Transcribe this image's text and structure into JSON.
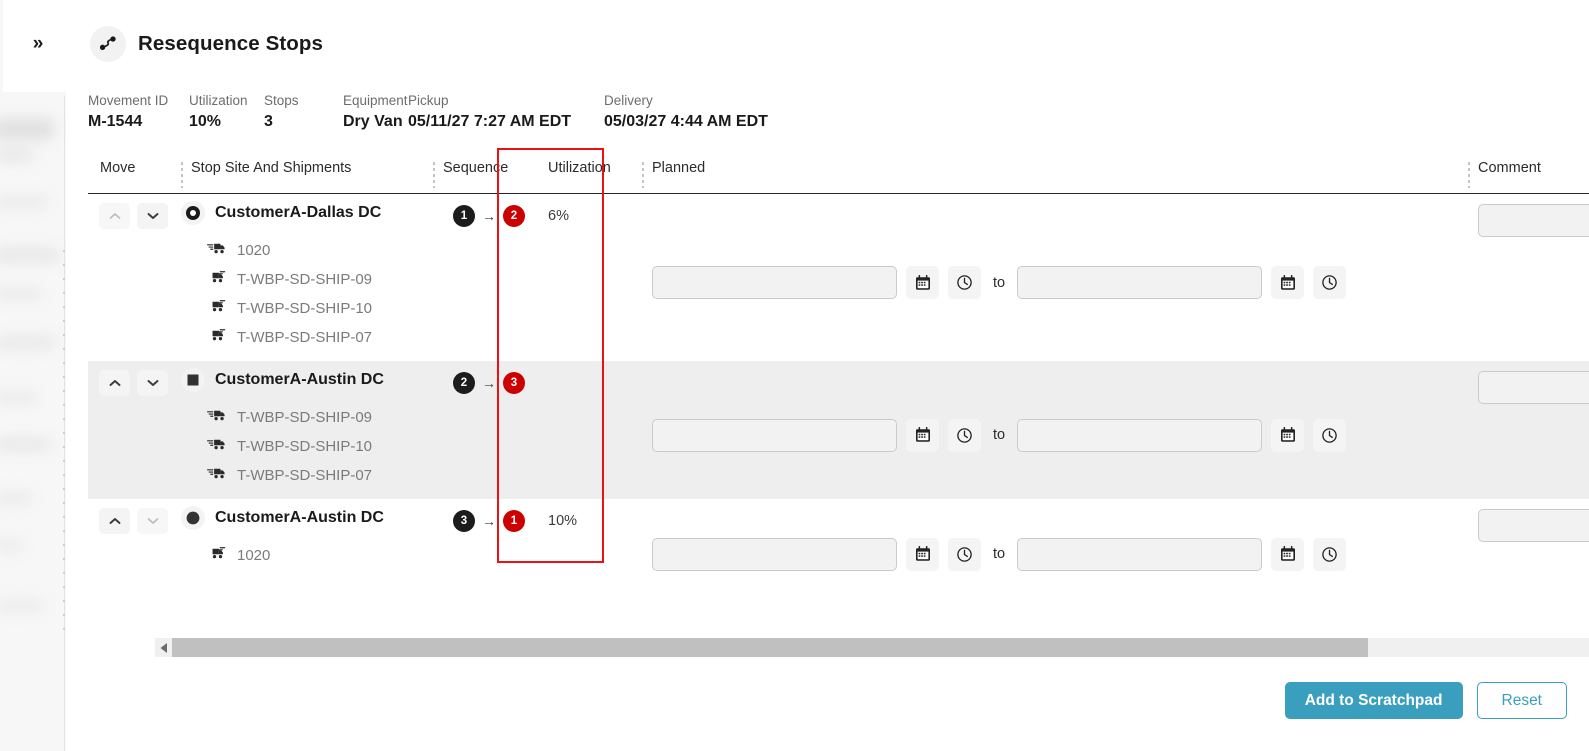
{
  "window": {
    "expand_button_label": "»",
    "title": "Resequence Stops",
    "title_icon": "route-stops-icon"
  },
  "summary": [
    {
      "label": "Movement ID",
      "value": "M-1544"
    },
    {
      "label": "Utilization",
      "value": "10%"
    },
    {
      "label": "Stops",
      "value": "3"
    },
    {
      "label": "Equipment",
      "value": "Dry Van"
    },
    {
      "label": "Pickup",
      "value": "05/11/27 7:27 AM EDT"
    },
    {
      "label": "Delivery",
      "value": "05/03/27 4:44 AM EDT"
    }
  ],
  "table": {
    "columns": [
      {
        "key": "move",
        "label": "Move"
      },
      {
        "key": "site",
        "label": "Stop Site And Shipments"
      },
      {
        "key": "sequence",
        "label": "Sequence"
      },
      {
        "key": "utilization",
        "label": "Utilization"
      },
      {
        "key": "planned",
        "label": "Planned"
      },
      {
        "key": "comment",
        "label": "Comment"
      }
    ],
    "rows": [
      {
        "marker": "origin-ring-icon",
        "site": "CustomerA-Dallas DC",
        "sequence_current": "1",
        "sequence_new": "2",
        "sequence_arrow": "→",
        "utilization": "6%",
        "move_up_enabled": false,
        "move_down_enabled": true,
        "highlighted": false,
        "shipments": [
          {
            "icon": "truck-arrive-icon",
            "label": "1020"
          },
          {
            "icon": "truck-depart-icon",
            "label": "T-WBP-SD-SHIP-09"
          },
          {
            "icon": "truck-depart-icon",
            "label": "T-WBP-SD-SHIP-10"
          },
          {
            "icon": "truck-depart-icon",
            "label": "T-WBP-SD-SHIP-07"
          }
        ],
        "planned": {
          "date_value": "",
          "time_value": "",
          "to_label": "to",
          "date_icon": "calendar-icon",
          "time_icon": "clock-icon"
        },
        "comment": ""
      },
      {
        "marker": "stop-square-icon",
        "site": "CustomerA-Austin DC",
        "sequence_current": "2",
        "sequence_new": "3",
        "sequence_arrow": "→",
        "utilization": "",
        "move_up_enabled": true,
        "move_down_enabled": true,
        "highlighted": true,
        "shipments": [
          {
            "icon": "truck-arrive-icon",
            "label": "T-WBP-SD-SHIP-09"
          },
          {
            "icon": "truck-arrive-icon",
            "label": "T-WBP-SD-SHIP-10"
          },
          {
            "icon": "truck-arrive-icon",
            "label": "T-WBP-SD-SHIP-07"
          }
        ],
        "planned": {
          "date_value": "",
          "time_value": "",
          "to_label": "to",
          "date_icon": "calendar-icon",
          "time_icon": "clock-icon"
        },
        "comment": ""
      },
      {
        "marker": "destination-dot-icon",
        "site": "CustomerA-Austin DC",
        "sequence_current": "3",
        "sequence_new": "1",
        "sequence_arrow": "→",
        "utilization": "10%",
        "move_up_enabled": true,
        "move_down_enabled": false,
        "highlighted": false,
        "shipments": [
          {
            "icon": "truck-depart-icon",
            "label": "1020"
          }
        ],
        "planned": {
          "date_value": "",
          "time_value": "",
          "to_label": "to",
          "date_icon": "calendar-icon",
          "time_icon": "clock-icon"
        },
        "comment": ""
      }
    ]
  },
  "scrollbar": {
    "left_arrow": "◀",
    "right_arrow": "▶"
  },
  "footer": {
    "primary_label": "Add to Scratchpad",
    "secondary_label": "Reset"
  },
  "colors": {
    "accent": "#3a9fbf",
    "sequence_current": "#1c1c1c",
    "sequence_new": "#cc0000",
    "highlight_border": "#ee1111",
    "row_alt_bg": "#eeeeee"
  }
}
